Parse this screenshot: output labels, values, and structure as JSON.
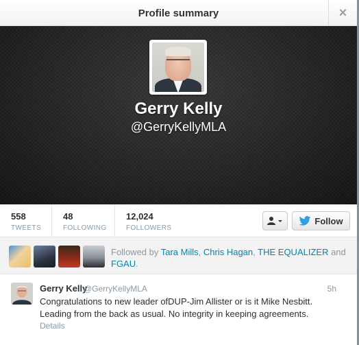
{
  "modal": {
    "title": "Profile summary",
    "close_glyph": "×"
  },
  "profile": {
    "name": "Gerry Kelly",
    "handle": "@GerryKellyMLA"
  },
  "stats": [
    {
      "count": "558",
      "label": "TWEETS"
    },
    {
      "count": "48",
      "label": "FOLLOWING"
    },
    {
      "count": "12,024",
      "label": "FOLLOWERS"
    }
  ],
  "actions": {
    "user_menu_icon": "user-dropdown-icon",
    "follow_label": "Follow",
    "follow_icon": "twitter-bird-icon"
  },
  "followed_by": {
    "prefix": "Followed by ",
    "names": [
      "Tara Mills",
      "Chris Hagan",
      "THE EQUALIZER",
      "FGAU"
    ],
    "sep1": ", ",
    "sep2": ", ",
    "sep3": " and ",
    "suffix": "."
  },
  "tweet": {
    "author": "Gerry Kelly",
    "handle": "@GerryKellyMLA",
    "time": "5h",
    "text": "Congratulations to new leader ofDUP-Jim Allister or is it Mike Nesbitt. Leading from the back as usual. No integrity in keeping agreements.",
    "details_label": "Details"
  },
  "colors": {
    "link": "#0084b4",
    "muted": "#8899a6",
    "twitter_blue": "#2ea0e6",
    "banner": "#262626"
  }
}
